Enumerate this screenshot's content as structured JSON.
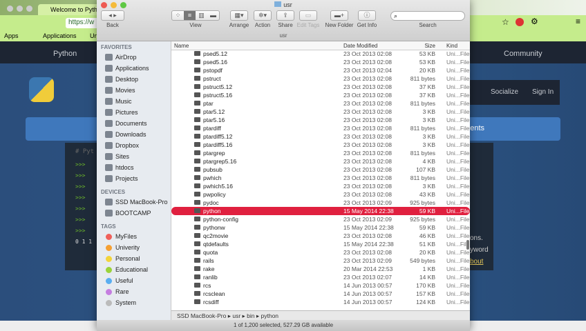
{
  "browser": {
    "tab_title": "Welcome to Python",
    "address": "https://w",
    "bookmarks": [
      "Apps",
      "Applications",
      "Un"
    ],
    "nav": {
      "python": "Python",
      "community": "Community"
    },
    "buttons": {
      "socialize": "Socialize",
      "signin": "Sign In",
      "events": "ents"
    },
    "site_text": [
      "ons.",
      "yword",
      "bout"
    ],
    "prompts": [
      ">>>",
      ">>>",
      ">>>",
      ">>>",
      ">>>",
      ">>>",
      ">>>"
    ],
    "output": "0 1 1",
    "comment": "# Pyt"
  },
  "finder": {
    "title": "usr",
    "path_title": "usr",
    "toolbar": {
      "back": "Back",
      "view": "View",
      "arrange": "Arrange",
      "action": "Action",
      "share": "Share",
      "edit_tags": "Edit Tags",
      "new_folder": "New Folder",
      "get_info": "Get Info",
      "search": "Search"
    },
    "sidebar": {
      "favorites_header": "FAVORITES",
      "favorites": [
        "AirDrop",
        "Applications",
        "Desktop",
        "Movies",
        "Music",
        "Pictures",
        "Documents",
        "Downloads",
        "Dropbox",
        "Sites",
        "htdocs",
        "Projects"
      ],
      "devices_header": "DEVICES",
      "devices": [
        "SSD MacBook-Pro",
        "BOOTCAMP"
      ],
      "tags_header": "TAGS",
      "tags": [
        {
          "label": "MyFiles",
          "color": "#f0605a"
        },
        {
          "label": "Univerity",
          "color": "#f5a033"
        },
        {
          "label": "Personal",
          "color": "#f3d43a"
        },
        {
          "label": "Educational",
          "color": "#9bd33a"
        },
        {
          "label": "Useful",
          "color": "#5aaef0"
        },
        {
          "label": "Rare",
          "color": "#c57ee0"
        },
        {
          "label": "System",
          "color": "#bbbbbb"
        }
      ]
    },
    "columns": {
      "name": "Name",
      "date": "Date Modified",
      "size": "Size",
      "kind": "Kind"
    },
    "files": [
      [
        "psed5.12",
        "23 Oct 2013 02:08",
        "53 KB"
      ],
      [
        "psed5.16",
        "23 Oct 2013 02:08",
        "53 KB"
      ],
      [
        "pstopdf",
        "23 Oct 2013 02:04",
        "20 KB"
      ],
      [
        "pstruct",
        "23 Oct 2013 02:08",
        "811 bytes"
      ],
      [
        "pstruct5.12",
        "23 Oct 2013 02:08",
        "37 KB"
      ],
      [
        "pstruct5.16",
        "23 Oct 2013 02:08",
        "37 KB"
      ],
      [
        "ptar",
        "23 Oct 2013 02:08",
        "811 bytes"
      ],
      [
        "ptar5.12",
        "23 Oct 2013 02:08",
        "3 KB"
      ],
      [
        "ptar5.16",
        "23 Oct 2013 02:08",
        "3 KB"
      ],
      [
        "ptardiff",
        "23 Oct 2013 02:08",
        "811 bytes"
      ],
      [
        "ptardiff5.12",
        "23 Oct 2013 02:08",
        "3 KB"
      ],
      [
        "ptardiff5.16",
        "23 Oct 2013 02:08",
        "3 KB"
      ],
      [
        "ptargrep",
        "23 Oct 2013 02:08",
        "811 bytes"
      ],
      [
        "ptargrep5.16",
        "23 Oct 2013 02:08",
        "4 KB"
      ],
      [
        "pubsub",
        "23 Oct 2013 02:08",
        "107 KB"
      ],
      [
        "pwhich",
        "23 Oct 2013 02:08",
        "811 bytes"
      ],
      [
        "pwhich5.16",
        "23 Oct 2013 02:08",
        "3 KB"
      ],
      [
        "pwpolicy",
        "23 Oct 2013 02:08",
        "43 KB"
      ],
      [
        "pydoc",
        "23 Oct 2013 02:09",
        "925 bytes"
      ],
      [
        "python",
        "15 May 2014 22:38",
        "59 KB"
      ],
      [
        "python-config",
        "23 Oct 2013 02:09",
        "925 bytes"
      ],
      [
        "pythonw",
        "15 May 2014 22:38",
        "59 KB"
      ],
      [
        "qc2movie",
        "23 Oct 2013 02:08",
        "46 KB"
      ],
      [
        "qtdefaults",
        "15 May 2014 22:38",
        "51 KB"
      ],
      [
        "quota",
        "23 Oct 2013 02:08",
        "20 KB"
      ],
      [
        "rails",
        "23 Oct 2013 02:09",
        "549 bytes"
      ],
      [
        "rake",
        "20 Mar 2014 22:53",
        "1 KB"
      ],
      [
        "ranlib",
        "23 Oct 2013 02:07",
        "14 KB"
      ],
      [
        "rcs",
        "14 Jun 2013 00:57",
        "170 KB"
      ],
      [
        "rcsclean",
        "14 Jun 2013 00:57",
        "157 KB"
      ],
      [
        "rcsdiff",
        "14 Jun 2013 00:57",
        "124 KB"
      ]
    ],
    "kind": "Uni...File",
    "selected": "python",
    "path": [
      "SSD MacBook-Pro",
      "usr",
      "bin",
      "python"
    ],
    "status": "1 of 1,200 selected, 527.29 GB available",
    "accent": "#e0203f"
  }
}
